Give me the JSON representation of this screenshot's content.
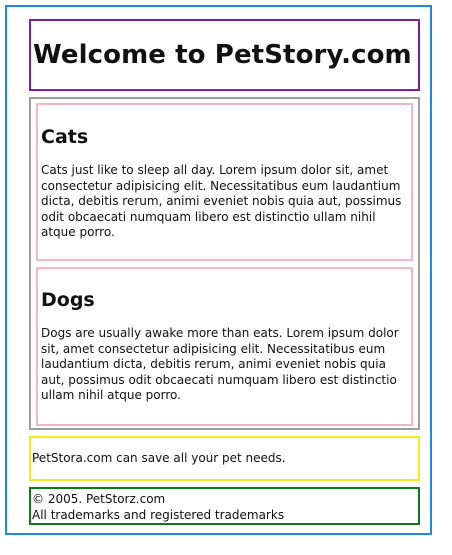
{
  "header": {
    "title": "Welcome to PetStory.com"
  },
  "articles": [
    {
      "title": "Cats",
      "text": "Cats just like to sleep all day. Lorem ipsum dolor sit, amet consectetur adipisicing elit. Necessitatibus eum laudantium dicta, debitis rerum, animi eveniet nobis quia aut, possimus odit obcaecati numquam libero est distinctio ullam nihil atque porro."
    },
    {
      "title": "Dogs",
      "text": "Dogs are usually awake more than eats. Lorem ipsum dolor sit, amet consectetur adipisicing elit. Necessitatibus eum laudantium dicta, debitis rerum, animi eveniet nobis quia aut, possimus odit obcaecati numquam libero est distinctio ullam nihil atque porro."
    }
  ],
  "tagline": "PetStora.com can save all your pet needs.",
  "footer": {
    "copyright": "© 2005. PetStorz.com",
    "trademarks": "All trademarks and registered trademarks"
  },
  "colors": {
    "page_border": "#1e88e5",
    "header_border": "#7b1fa2",
    "main_border": "#9e9e9e",
    "article_border": "#f4b6c2",
    "tagline_border": "#f2ec1d",
    "footer_border": "#0d7a1a"
  }
}
